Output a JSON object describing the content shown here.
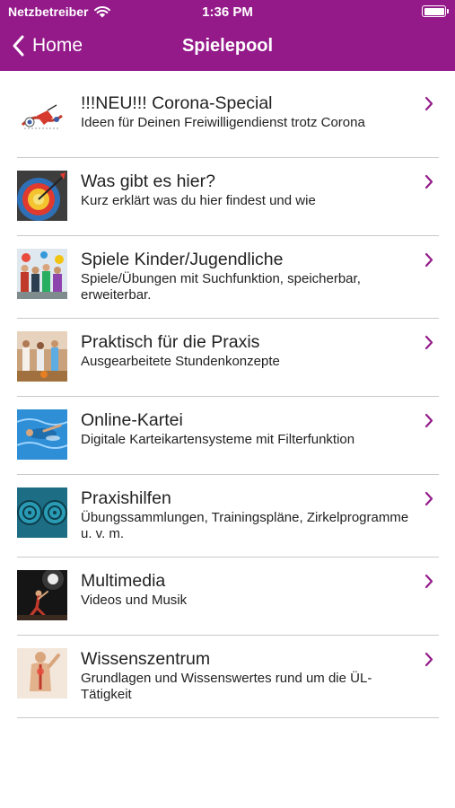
{
  "status_bar": {
    "carrier": "Netzbetreiber",
    "time": "1:36 PM",
    "battery_level": 1.0
  },
  "nav": {
    "back_label": "Home",
    "title": "Spielepool"
  },
  "colors": {
    "brand": "#941a8a",
    "chevron": "#941a8a",
    "separator": "#c9c9c9"
  },
  "items": [
    {
      "title": "!!!NEU!!! Corona-Special",
      "subtitle": "Ideen für Deinen Freiwilligendienst trotz Corona",
      "icon": "corona-special-thumbnail"
    },
    {
      "title": "Was gibt es hier?",
      "subtitle": "Kurz erklärt was du hier findest und wie",
      "icon": "target-thumbnail"
    },
    {
      "title": "Spiele Kinder/Jugendliche",
      "subtitle": "Spiele/Übungen mit Suchfunktion, speicherbar, erweiterbar.",
      "icon": "kids-group-thumbnail"
    },
    {
      "title": "Praktisch für die Praxis",
      "subtitle": "Ausgearbeitete Stundenkonzepte",
      "icon": "gym-class-thumbnail"
    },
    {
      "title": "Online-Kartei",
      "subtitle": "Digitale Karteikartensysteme mit Filterfunktion",
      "icon": "swimmer-thumbnail"
    },
    {
      "title": "Praxishilfen",
      "subtitle": "Übungssammlungen, Trainingspläne, Zirkelprogramme u. v. m.",
      "icon": "weight-plates-thumbnail"
    },
    {
      "title": "Multimedia",
      "subtitle": "Videos und Musik",
      "icon": "dancer-thumbnail"
    },
    {
      "title": "Wissenszentrum",
      "subtitle": "Grundlagen und Wissenswertes rund um die ÜL-Tätigkeit",
      "icon": "anatomy-thumbnail"
    }
  ]
}
